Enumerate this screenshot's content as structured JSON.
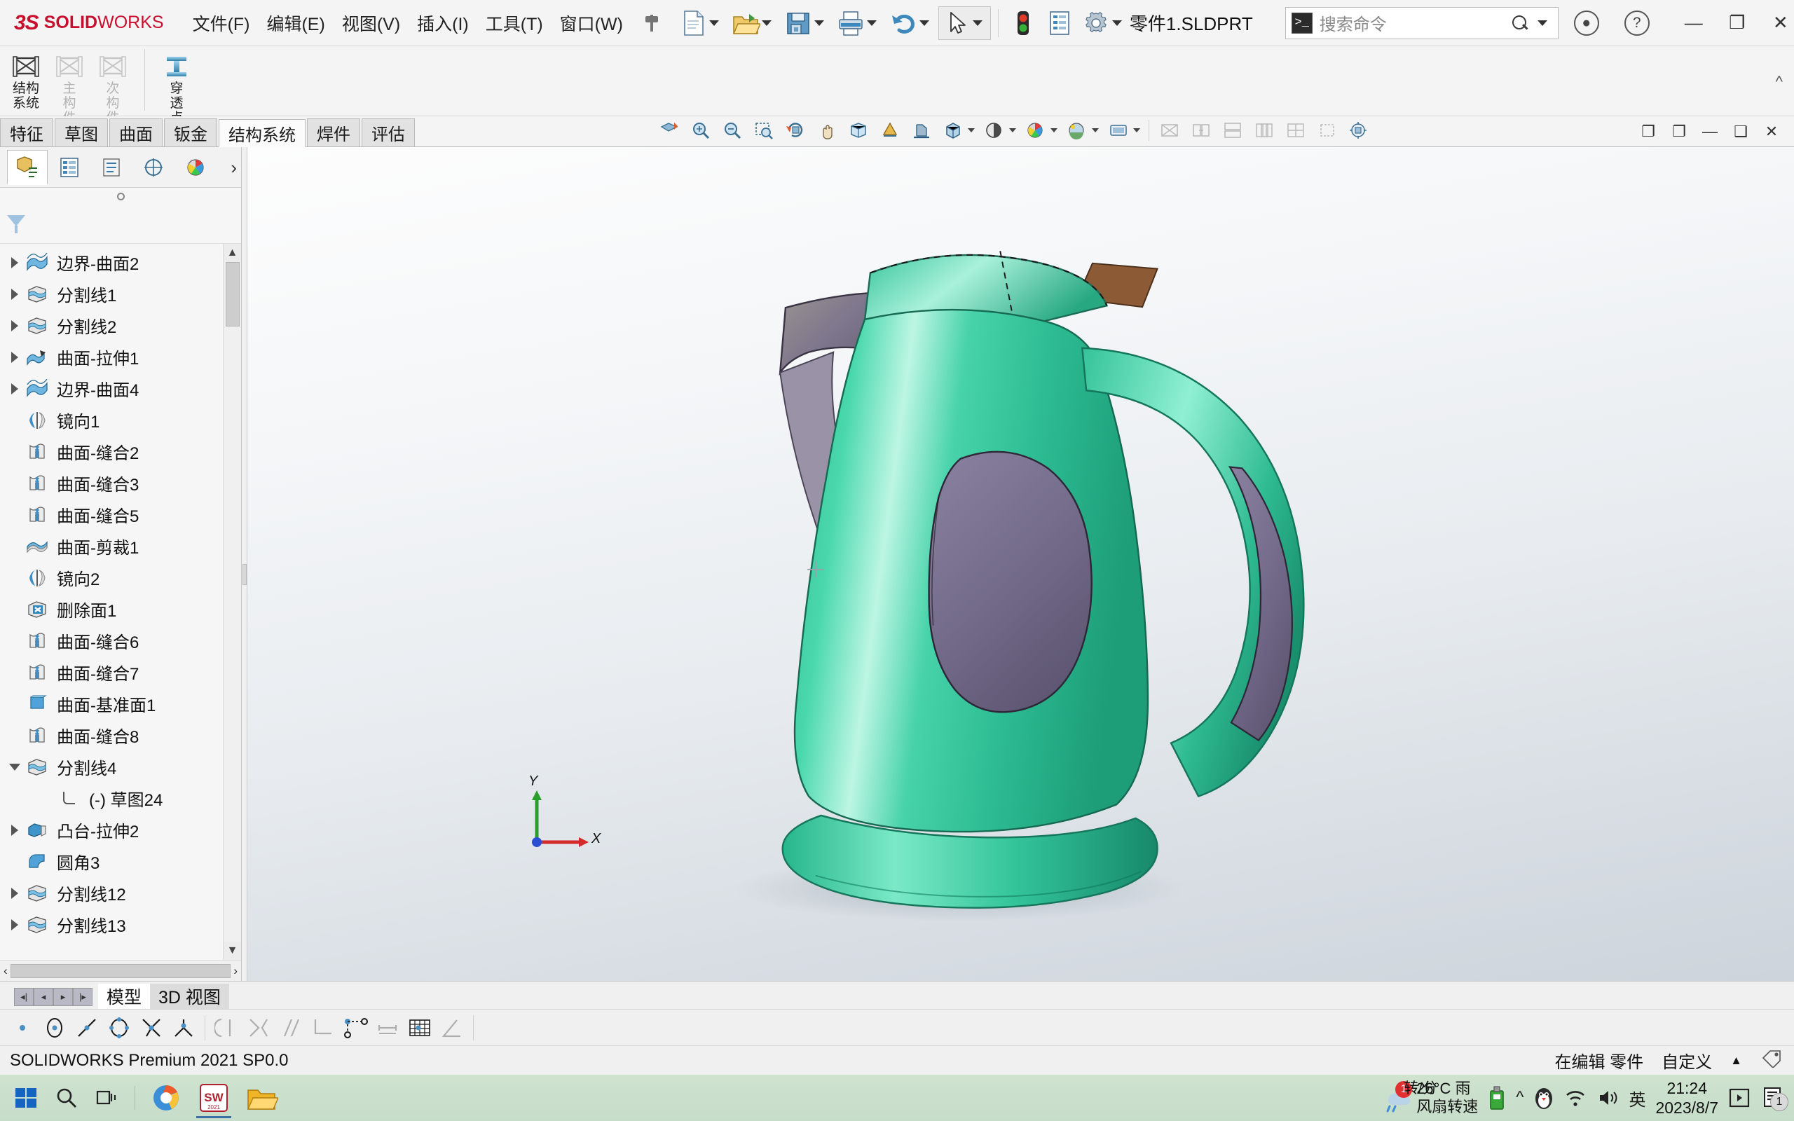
{
  "app": {
    "brand_mark": "3S",
    "brand_name_bold": "SOLID",
    "brand_name_thin": "WORKS",
    "brand_color": "#c8102e",
    "document_title": "零件1.SLDPRT",
    "version_status": "SOLIDWORKS Premium 2021 SP0.0"
  },
  "menu": {
    "items": [
      {
        "label": "文件(F)"
      },
      {
        "label": "编辑(E)"
      },
      {
        "label": "视图(V)"
      },
      {
        "label": "插入(I)"
      },
      {
        "label": "工具(T)"
      },
      {
        "label": "窗口(W)"
      }
    ],
    "pin_icon": "pushpin-icon"
  },
  "quick_toolbar": {
    "items": [
      {
        "name": "new-document",
        "icon": "new-document-icon",
        "has_dropdown": true
      },
      {
        "name": "open-document",
        "icon": "open-folder-icon",
        "has_dropdown": true
      },
      {
        "name": "save-document",
        "icon": "floppy-save-icon",
        "has_dropdown": true
      },
      {
        "name": "print-document",
        "icon": "printer-icon",
        "has_dropdown": true
      },
      {
        "name": "undo",
        "icon": "undo-arrow-icon",
        "has_dropdown": true
      },
      {
        "name": "select",
        "icon": "mouse-cursor-icon",
        "has_dropdown": true
      },
      {
        "name": "rebuild",
        "icon": "traffic-light-icon",
        "has_dropdown": false
      },
      {
        "name": "file-properties",
        "icon": "document-properties-icon",
        "has_dropdown": false
      },
      {
        "name": "options",
        "icon": "gear-icon",
        "has_dropdown": true
      }
    ]
  },
  "search": {
    "placeholder": "搜索命令",
    "command_icon": "command-prompt-icon",
    "search_icon": "search-icon",
    "dropdown_icon": "chevron-down-icon"
  },
  "window_controls": {
    "account_icon": "user-account-icon",
    "help_icon": "help-question-icon",
    "minimize": "—",
    "restore": "❐",
    "close": "✕"
  },
  "ribbon": {
    "buttons": [
      {
        "name": "structure-system",
        "line1": "结构",
        "line2": "系统",
        "icon": "structure-frame-icon",
        "disabled": false
      },
      {
        "name": "primary-member",
        "line1": "主",
        "line2": "构",
        "line3": "件",
        "icon": "primary-member-icon",
        "disabled": true
      },
      {
        "name": "secondary-member",
        "line1": "次",
        "line2": "构",
        "line3": "件",
        "icon": "secondary-member-icon",
        "disabled": true
      },
      {
        "name": "penetration-point",
        "line1": "穿",
        "line2": "透",
        "line3": "点",
        "icon": "i-beam-icon",
        "disabled": false
      }
    ],
    "collapse_icon": "chevron-up-icon"
  },
  "command_tabs": [
    {
      "label": "特征",
      "active": false
    },
    {
      "label": "草图",
      "active": false
    },
    {
      "label": "曲面",
      "active": false
    },
    {
      "label": "钣金",
      "active": false
    },
    {
      "label": "结构系统",
      "active": true
    },
    {
      "label": "焊件",
      "active": false
    },
    {
      "label": "评估",
      "active": false
    }
  ],
  "view_toolbar": [
    {
      "name": "zoom-to-fit",
      "icon": "magnify-fit-icon",
      "disabled": false
    },
    {
      "name": "zoom-to-area",
      "icon": "magnify-area-icon",
      "disabled": false
    },
    {
      "name": "zoom-in-out",
      "icon": "magnify-inout-icon",
      "disabled": false
    },
    {
      "name": "zoom-to-selection",
      "icon": "magnify-selection-icon",
      "disabled": false
    },
    {
      "name": "rotate-view",
      "icon": "rotate-view-icon",
      "disabled": false
    },
    {
      "name": "pan",
      "icon": "pan-hand-icon",
      "disabled": false
    },
    {
      "name": "3d-drawing-view",
      "icon": "3d-drawing-icon",
      "disabled": false
    },
    {
      "name": "view-orientation",
      "icon": "view-orientation-cube-icon",
      "disabled": false,
      "has_dropdown": true
    },
    {
      "name": "section-view",
      "icon": "section-view-icon",
      "disabled": false
    },
    {
      "name": "view-orientation-2",
      "icon": "isometric-cube-icon",
      "disabled": false,
      "has_dropdown": true
    },
    {
      "name": "display-style",
      "icon": "display-style-icon",
      "disabled": false,
      "has_dropdown": true
    },
    {
      "name": "hide-show-items",
      "icon": "glasses-icon",
      "disabled": false,
      "has_dropdown": true
    },
    {
      "name": "edit-appearance",
      "icon": "appearance-sphere-icon",
      "disabled": false,
      "has_dropdown": true
    },
    {
      "name": "apply-scene",
      "icon": "scene-sphere-icon",
      "disabled": false,
      "has_dropdown": true
    },
    {
      "name": "view-settings",
      "icon": "view-settings-icon",
      "disabled": false,
      "has_dropdown": true
    },
    {
      "name": "hide-all-types",
      "icon": "hide-types-icon",
      "disabled": true
    },
    {
      "name": "tile-horizontally",
      "icon": "tile-horizontal-icon",
      "disabled": true
    },
    {
      "name": "tile-vertically",
      "icon": "tile-vertical-icon",
      "disabled": true
    },
    {
      "name": "cascade",
      "icon": "cascade-icon",
      "disabled": true
    },
    {
      "name": "tile-windows",
      "icon": "tile-windows-icon",
      "disabled": true
    },
    {
      "name": "new-window",
      "icon": "new-window-icon",
      "disabled": true
    },
    {
      "name": "viewport-4",
      "icon": "four-viewport-icon",
      "disabled": true
    },
    {
      "name": "view-selector",
      "icon": "view-selector-icon",
      "disabled": false
    }
  ],
  "document_window_controls": [
    {
      "name": "doc-restore",
      "icon": "doc-restore-icon"
    },
    {
      "name": "doc-split",
      "icon": "doc-split-icon"
    },
    {
      "name": "doc-minimize",
      "icon": "doc-minimize-icon"
    },
    {
      "name": "doc-maximize",
      "icon": "doc-maximize-icon"
    },
    {
      "name": "doc-close",
      "icon": "doc-close-icon"
    }
  ],
  "feature_manager": {
    "tabs": [
      {
        "name": "feature-manager-tree",
        "icon": "feature-tree-icon",
        "active": true
      },
      {
        "name": "property-manager",
        "icon": "property-manager-icon",
        "active": false
      },
      {
        "name": "configuration-manager",
        "icon": "configuration-manager-icon",
        "active": false
      },
      {
        "name": "dimxpert-manager",
        "icon": "dimxpert-icon",
        "active": false
      },
      {
        "name": "display-manager",
        "icon": "display-manager-icon",
        "active": false
      }
    ],
    "more_icon": "chevron-right-icon",
    "filter_icon": "filter-funnel-icon",
    "tree": [
      {
        "label": "边界-曲面2",
        "icon": "boundary-surface-icon",
        "expandable": true,
        "expanded": false,
        "indent": 0
      },
      {
        "label": "分割线1",
        "icon": "split-line-icon",
        "expandable": true,
        "expanded": false,
        "indent": 0
      },
      {
        "label": "分割线2",
        "icon": "split-line-icon",
        "expandable": true,
        "expanded": false,
        "indent": 0
      },
      {
        "label": "曲面-拉伸1",
        "icon": "extruded-surface-icon",
        "expandable": true,
        "expanded": false,
        "indent": 0
      },
      {
        "label": "边界-曲面4",
        "icon": "boundary-surface-icon",
        "expandable": true,
        "expanded": false,
        "indent": 0
      },
      {
        "label": "镜向1",
        "icon": "mirror-icon",
        "expandable": false,
        "expanded": false,
        "indent": 0
      },
      {
        "label": "曲面-缝合2",
        "icon": "knit-surface-icon",
        "expandable": false,
        "expanded": false,
        "indent": 0
      },
      {
        "label": "曲面-缝合3",
        "icon": "knit-surface-icon",
        "expandable": false,
        "expanded": false,
        "indent": 0
      },
      {
        "label": "曲面-缝合5",
        "icon": "knit-surface-icon",
        "expandable": false,
        "expanded": false,
        "indent": 0
      },
      {
        "label": "曲面-剪裁1",
        "icon": "trim-surface-icon",
        "expandable": false,
        "expanded": false,
        "indent": 0
      },
      {
        "label": "镜向2",
        "icon": "mirror-icon",
        "expandable": false,
        "expanded": false,
        "indent": 0
      },
      {
        "label": "删除面1",
        "icon": "delete-face-icon",
        "expandable": false,
        "expanded": false,
        "indent": 0
      },
      {
        "label": "曲面-缝合6",
        "icon": "knit-surface-icon",
        "expandable": false,
        "expanded": false,
        "indent": 0
      },
      {
        "label": "曲面-缝合7",
        "icon": "knit-surface-icon",
        "expandable": false,
        "expanded": false,
        "indent": 0
      },
      {
        "label": "曲面-基准面1",
        "icon": "planar-surface-icon",
        "expandable": false,
        "expanded": false,
        "indent": 0
      },
      {
        "label": "曲面-缝合8",
        "icon": "knit-surface-icon",
        "expandable": false,
        "expanded": false,
        "indent": 0
      },
      {
        "label": "分割线4",
        "icon": "split-line-icon",
        "expandable": true,
        "expanded": true,
        "indent": 0
      },
      {
        "label": "(-) 草图24",
        "icon": "sketch-icon",
        "expandable": false,
        "expanded": false,
        "indent": 1
      },
      {
        "label": "凸台-拉伸2",
        "icon": "boss-extrude-icon",
        "expandable": true,
        "expanded": false,
        "indent": 0
      },
      {
        "label": "圆角3",
        "icon": "fillet-icon",
        "expandable": false,
        "expanded": false,
        "indent": 0
      },
      {
        "label": "分割线12",
        "icon": "split-line-icon",
        "expandable": true,
        "expanded": false,
        "indent": 0
      },
      {
        "label": "分割线13",
        "icon": "split-line-icon",
        "expandable": true,
        "expanded": false,
        "indent": 0
      }
    ],
    "hscroll": {
      "left_icon": "chevron-left-icon",
      "right_icon": "chevron-right-icon"
    },
    "vscroll": {
      "up_icon": "chevron-up-icon",
      "down_icon": "chevron-down-icon"
    }
  },
  "graphics": {
    "model_name": "electric-kettle",
    "colors": {
      "body_green": "#3fc9a0",
      "body_green_dark": "#1a9a78",
      "body_highlight": "#b8f0de",
      "patch_purple": "#7b7390",
      "patch_purple_light": "#9a93ad",
      "spout_brown": "#8d5a36",
      "edge_line": "#2a2a2a",
      "background_top": "#fdfdfd",
      "background_bottom": "#cdd4db"
    },
    "triad": {
      "x_label": "X",
      "y_label": "Y",
      "z_label": "",
      "x_color": "#d42a2a",
      "y_color": "#2aa02a",
      "z_color": "#2a4fd4"
    }
  },
  "bottom_tabs": {
    "nav_icons": [
      "first-icon",
      "prev-icon",
      "next-icon",
      "last-icon"
    ],
    "tabs": [
      {
        "label": "模型",
        "active": true
      },
      {
        "label": "3D 视图",
        "active": false
      }
    ]
  },
  "sketch_toolbar": [
    {
      "name": "point-relation",
      "icon": "point-icon",
      "disabled": false
    },
    {
      "name": "circle-relation",
      "icon": "circle-point-icon",
      "disabled": false
    },
    {
      "name": "line-relation",
      "icon": "line-point-icon",
      "disabled": false
    },
    {
      "name": "ellipse-relation",
      "icon": "ellipse-points-icon",
      "disabled": false
    },
    {
      "name": "intersection-relation",
      "icon": "intersection-icon",
      "disabled": false
    },
    {
      "name": "merge-relation",
      "icon": "merge-points-icon",
      "disabled": false
    },
    {
      "name": "tangent-relation",
      "icon": "tangent-icon",
      "disabled": true
    },
    {
      "name": "symmetric-relation",
      "icon": "symmetric-icon",
      "disabled": true
    },
    {
      "name": "parallel-relation",
      "icon": "parallel-icon",
      "disabled": true
    },
    {
      "name": "perpendicular-relation",
      "icon": "perpendicular-icon",
      "disabled": true
    },
    {
      "name": "collinear-relation",
      "icon": "collinear-icon",
      "disabled": false
    },
    {
      "name": "equal-relation",
      "icon": "equal-length-icon",
      "disabled": true
    },
    {
      "name": "grid-relation",
      "icon": "grid-icon",
      "disabled": false
    },
    {
      "name": "angle-relation",
      "icon": "angle-icon",
      "disabled": true
    }
  ],
  "status_bar": {
    "left": "SOLIDWORKS Premium 2021 SP0.0",
    "editing": "在编辑 零件",
    "custom": "自定义",
    "custom_caret": "chevron-up-icon",
    "tag_icon": "tag-icon"
  },
  "taskbar": {
    "start_icon": "windows-start-icon",
    "search_icon": "search-icon",
    "taskview_icon": "task-view-icon",
    "apps": [
      {
        "name": "browser-app",
        "icon": "browser-icon"
      },
      {
        "name": "solidworks-app",
        "icon": "solidworks-icon",
        "active": true
      },
      {
        "name": "file-explorer-app",
        "icon": "folder-icon"
      }
    ],
    "tray": {
      "weather_temp": "26°C 雨",
      "weather_sub": "风扇转速",
      "fan_speed": "转/分",
      "notification_count": "1",
      "usb_icon": "usb-drive-icon",
      "overflow_icon": "chevron-up-icon",
      "qq_icon": "qq-penguin-icon",
      "wifi_icon": "wifi-icon",
      "volume_icon": "speaker-icon",
      "ime_label": "英",
      "time": "21:24",
      "date": "2023/8/7",
      "action_center_icon": "action-center-icon",
      "notes_icon": "notes-icon",
      "notes_badge": "1"
    }
  }
}
